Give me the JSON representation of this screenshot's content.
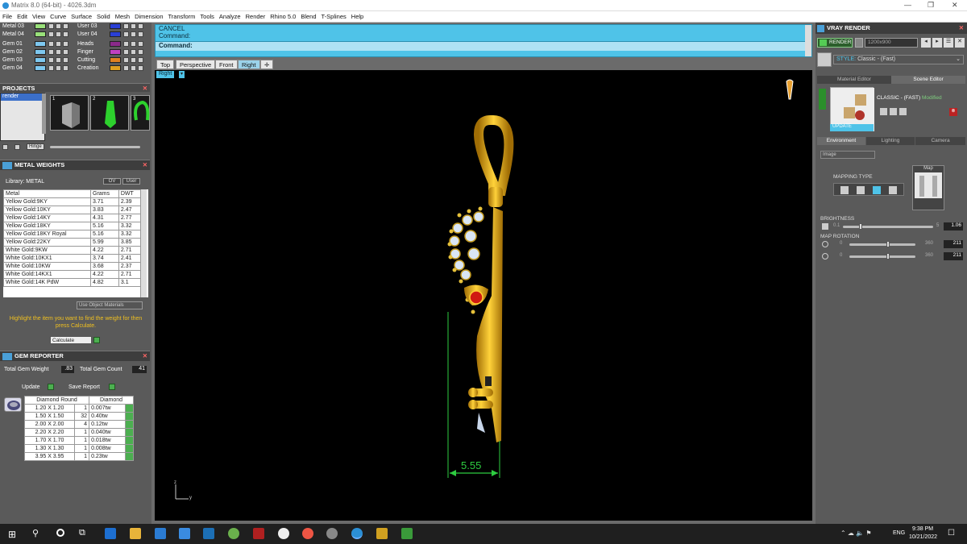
{
  "window": {
    "title": "Matrix 8.0 (64-bit) - 4026.3dm"
  },
  "menu": [
    "File",
    "Edit",
    "View",
    "Curve",
    "Surface",
    "Solid",
    "Mesh",
    "Dimension",
    "Transform",
    "Tools",
    "Analyze",
    "Render",
    "Rhino 5.0",
    "Blend",
    "T-Splines",
    "Help"
  ],
  "layers": {
    "left": [
      {
        "name": "Metal 03",
        "color": "#99e07a"
      },
      {
        "name": "Metal 04",
        "color": "#99e07a"
      },
      {
        "name": "Gem 01",
        "color": "#7ec8f0"
      },
      {
        "name": "Gem 02",
        "color": "#7ec8f0"
      },
      {
        "name": "Gem 03",
        "color": "#7ec8f0"
      },
      {
        "name": "Gem 04",
        "color": "#7ec8f0"
      }
    ],
    "right": [
      {
        "name": "User 03",
        "color": "#2a3fd6"
      },
      {
        "name": "User 04",
        "color": "#2a3fd6"
      },
      {
        "name": "Heads",
        "color": "#8a2a8a"
      },
      {
        "name": "Finger",
        "color": "#c040c0"
      },
      {
        "name": "Cutting",
        "color": "#e08020"
      },
      {
        "name": "Creation",
        "color": "#e0a020"
      }
    ]
  },
  "projects": {
    "title": "PROJECTS",
    "item": "render",
    "thumbs": [
      "1",
      "2",
      "3"
    ],
    "btn": "Hinge"
  },
  "metal_weights": {
    "title": "METAL WEIGHTS",
    "library": "Library: METAL",
    "lib_btns": [
      "OV",
      "User"
    ],
    "headers": [
      "Metal",
      "Grams",
      "DWT"
    ],
    "rows": [
      [
        "Yellow Gold:9KY",
        "3.71",
        "2.39"
      ],
      [
        "Yellow Gold:10KY",
        "3.83",
        "2.47"
      ],
      [
        "Yellow Gold:14KY",
        "4.31",
        "2.77"
      ],
      [
        "Yellow Gold:18KY",
        "5.16",
        "3.32"
      ],
      [
        "Yellow Gold:18KY Royal",
        "5.16",
        "3.32"
      ],
      [
        "Yellow Gold:22KY",
        "5.99",
        "3.85"
      ],
      [
        "White Gold:9KW",
        "4.22",
        "2.71"
      ],
      [
        "White Gold:10KX1",
        "3.74",
        "2.41"
      ],
      [
        "White Gold:10KW",
        "3.68",
        "2.37"
      ],
      [
        "White Gold:14KX1",
        "4.22",
        "2.71"
      ],
      [
        "White Gold:14K PdW",
        "4.82",
        "3.1"
      ]
    ],
    "use_obj": "Use Object Materials",
    "hint": "Highlight the item you want to find the weight for then press Calculate.",
    "calculate": "Calculate"
  },
  "gem_reporter": {
    "title": "GEM REPORTER",
    "total_weight_label": "Total Gem Weight",
    "total_weight": ".83",
    "total_count_label": "Total Gem Count",
    "total_count": "41",
    "update": "Update",
    "save": "Save Report",
    "headers": [
      "Diamond Round",
      "Diamond"
    ],
    "rows": [
      [
        "1.20 X 1.20",
        "1",
        "0.007tw"
      ],
      [
        "1.50 X 1.50",
        "32",
        "0.40tw"
      ],
      [
        "2.00 X 2.00",
        "4",
        "0.12tw"
      ],
      [
        "2.20 X 2.20",
        "1",
        "0.040tw"
      ],
      [
        "1.70 X 1.70",
        "1",
        "0.018tw"
      ],
      [
        "1.30 X 1.30",
        "1",
        "0.008tw"
      ],
      [
        "3.95 X 3.95",
        "1",
        "0.23tw"
      ]
    ]
  },
  "command": {
    "line1": "CANCEL",
    "line2": "Command:",
    "prompt": "Command:"
  },
  "view_tabs": [
    "Top",
    "Perspective",
    "Front",
    "Right"
  ],
  "active_view": "Right",
  "viewport": {
    "label": "Right",
    "dimension": "5.55",
    "axis_z": "z",
    "axis_y": "y"
  },
  "vray": {
    "title": "VRAY RENDER",
    "render_btn": "RENDER",
    "resolution": "1200x900",
    "style_label": "STYLE:",
    "style": "Classic - (Fast)",
    "tabs": [
      "Material Editor",
      "Scene Editor"
    ],
    "preset": "CLASSIC - (FAST)",
    "modified": "Modified",
    "update": "UPDATE",
    "env_tabs": [
      "Environment",
      "Lighting",
      "Camera"
    ],
    "env_type": "Image",
    "mapping_type": "MAPPING TYPE",
    "map": "Map",
    "brightness_label": "BRIGHTNESS",
    "brightness_min": "0.1",
    "brightness_max": "5",
    "brightness": "1.06",
    "rotation_label": "MAP ROTATION",
    "rot_min": "0",
    "rot_max": "360",
    "rot1": "211",
    "rot2": "211"
  },
  "taskbar": {
    "lang": "ENG",
    "time": "9:38 PM",
    "date": "10/21/2022"
  },
  "colors": {
    "cmd_bg": "#4fc3e8",
    "gold": "#e0b21a",
    "accent_green": "#4caf50"
  }
}
